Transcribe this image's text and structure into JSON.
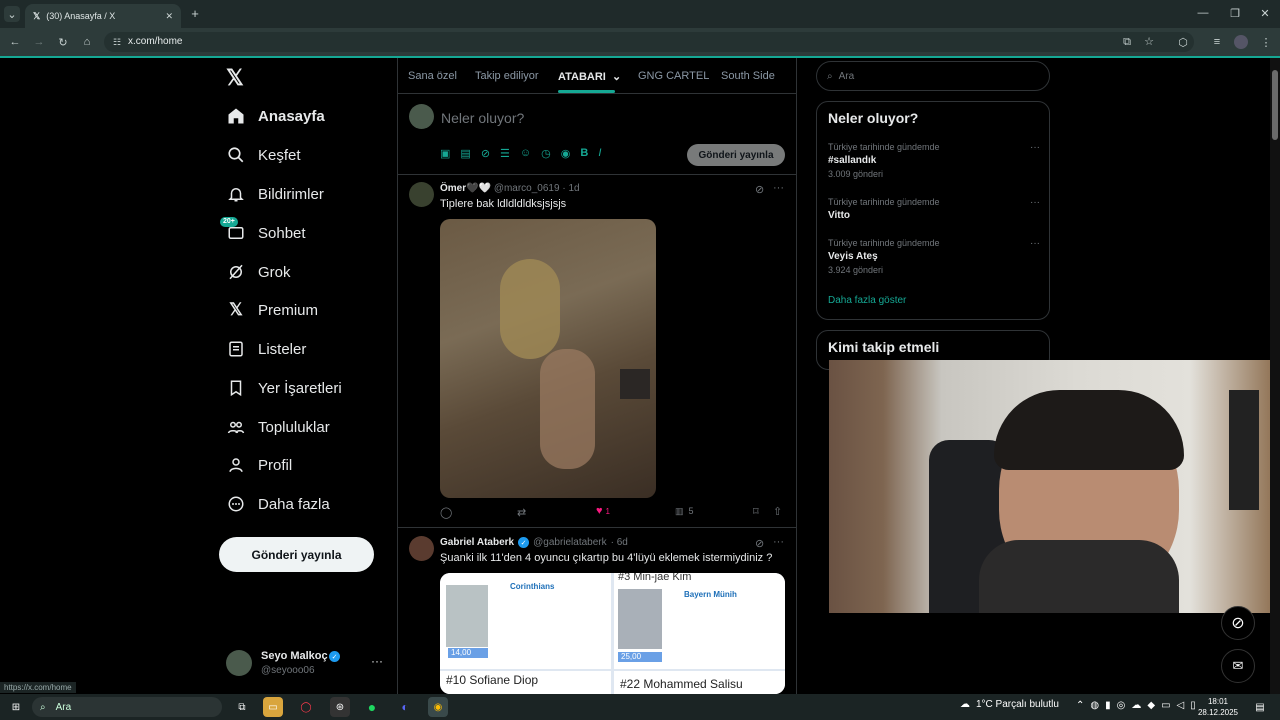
{
  "browser": {
    "tab_title": "(30) Anasayfa / X",
    "url": "x.com/home",
    "status_url": "https://x.com/home",
    "accent": "#15a894"
  },
  "sidebar": {
    "items": [
      {
        "label": "Anasayfa",
        "icon": "home-icon"
      },
      {
        "label": "Keşfet",
        "icon": "search-icon"
      },
      {
        "label": "Bildirimler",
        "icon": "bell-icon"
      },
      {
        "label": "Sohbet",
        "icon": "chat-icon",
        "badge": "20+"
      },
      {
        "label": "Grok",
        "icon": "grok-icon"
      },
      {
        "label": "Premium",
        "icon": "x-logo-icon"
      },
      {
        "label": "Listeler",
        "icon": "list-icon"
      },
      {
        "label": "Yer İşaretleri",
        "icon": "bookmark-icon"
      },
      {
        "label": "Topluluklar",
        "icon": "communities-icon"
      },
      {
        "label": "Profil",
        "icon": "profile-icon"
      },
      {
        "label": "Daha fazla",
        "icon": "more-circle-icon"
      }
    ],
    "post_button": "Gönderi yayınla",
    "account": {
      "name": "Seyo Malkoç",
      "handle": "@seyooo06"
    }
  },
  "feed": {
    "tabs": [
      "Sana özel",
      "Takip ediliyor",
      "ATABARI",
      "GNG CARTEL",
      "South Side"
    ],
    "active_tab": "ATABARI",
    "composer": {
      "placeholder": "Neler oluyor?",
      "post_button": "Gönderi yayınla"
    },
    "tweets": [
      {
        "name": "Ömer🖤🤍",
        "handle": "@marco_0619",
        "time": "· 1d",
        "text": "Tiplere bak ldldldldksjsjsjs",
        "likes": "1",
        "views": "5"
      },
      {
        "name": "Gabriel Ataberk",
        "handle": "@gabrielataberk",
        "time": "· 6d",
        "text": "Şuanki ilk 11'den 4 oyuncu çıkartıp bu 4'lüyü eklemek istermiydiniz ?",
        "cards": [
          {
            "club": "Corinthians",
            "rank": "",
            "price": "14,00",
            "caption": "#10 Sofiane Diop"
          },
          {
            "club": "Bayern Münih",
            "rank": "#3 Min-jae Kim",
            "price": "25,00",
            "caption": "#22 Mohammed Salisu"
          }
        ]
      }
    ]
  },
  "right": {
    "search_placeholder": "Ara",
    "trends_title": "Neler oluyor?",
    "trends": [
      {
        "category": "Türkiye tarihinde gündemde",
        "name": "#sallandık",
        "count": "3.009 gönderi"
      },
      {
        "category": "Türkiye tarihinde gündemde",
        "name": "Vitto",
        "count": ""
      },
      {
        "category": "Türkiye tarihinde gündemde",
        "name": "Veyis Ateş",
        "count": "3.924 gönderi"
      }
    ],
    "show_more": "Daha fazla göster",
    "who_to_follow": "Kimi takip etmeli"
  },
  "taskbar": {
    "search": "Ara",
    "weather": "1°C  Parçalı bulutlu",
    "time": "18:01",
    "date": "28.12.2025"
  }
}
